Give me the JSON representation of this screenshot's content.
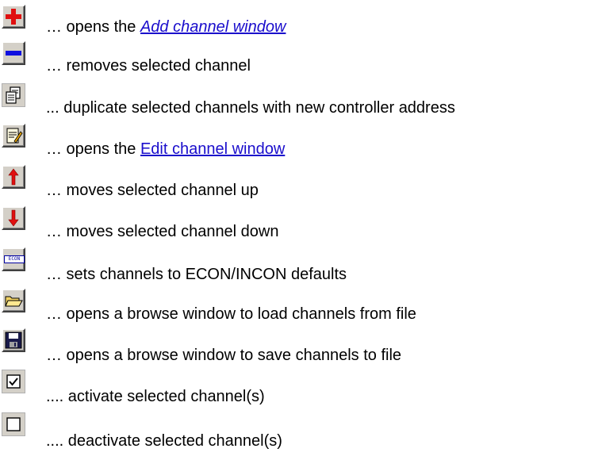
{
  "items": [
    {
      "icon": "add-channel-icon",
      "prefix": "… opens the ",
      "link": "Add channel window",
      "link_italic": true
    },
    {
      "icon": "remove-channel-icon",
      "text": "… removes selected channel"
    },
    {
      "icon": "duplicate-icon",
      "text": "...  duplicate selected channels with new controller address"
    },
    {
      "icon": "edit-channel-icon",
      "prefix": "… opens the ",
      "link": "Edit channel window",
      "link_italic": false
    },
    {
      "icon": "move-up-icon",
      "text": "… moves selected channel up"
    },
    {
      "icon": "move-down-icon",
      "text": "… moves selected channel down"
    },
    {
      "icon": "econ-icon",
      "icon_text": "ECON",
      "text": "… sets channels to ECON/INCON defaults"
    },
    {
      "icon": "open-folder-icon",
      "text": "… opens a browse window to load channels from file"
    },
    {
      "icon": "save-disk-icon",
      "text": "… opens a browse window to save channels to file"
    },
    {
      "icon": "checkbox-checked-icon",
      "text": "....  activate selected channel(s)"
    },
    {
      "icon": "checkbox-empty-icon",
      "text": "....  deactivate selected channel(s)"
    }
  ],
  "colors": {
    "link": "#1a0dcc",
    "plus": "#e01010",
    "minus": "#1010e0",
    "arrow": "#e01010",
    "button_face": "#d4d0c8"
  }
}
